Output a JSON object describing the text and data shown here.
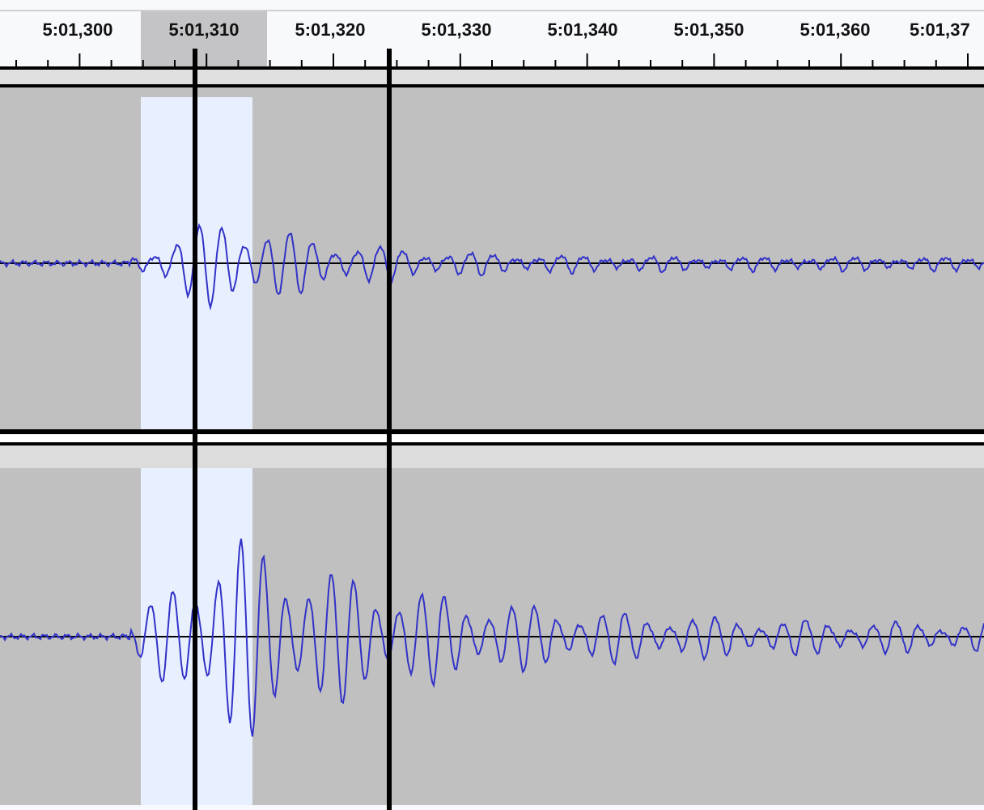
{
  "ruler": {
    "labels": [
      {
        "text": "5:01,300",
        "selected": false
      },
      {
        "text": "5:01,310",
        "selected": true
      },
      {
        "text": "5:01,320",
        "selected": false
      },
      {
        "text": "5:01,330",
        "selected": false
      },
      {
        "text": "5:01,340",
        "selected": false
      },
      {
        "text": "5:01,350",
        "selected": false
      },
      {
        "text": "5:01,360",
        "selected": false
      },
      {
        "text": "5:01,37",
        "selected": false
      }
    ]
  },
  "tracks": [
    {
      "kind": "waveform"
    },
    {
      "kind": "waveform"
    }
  ]
}
